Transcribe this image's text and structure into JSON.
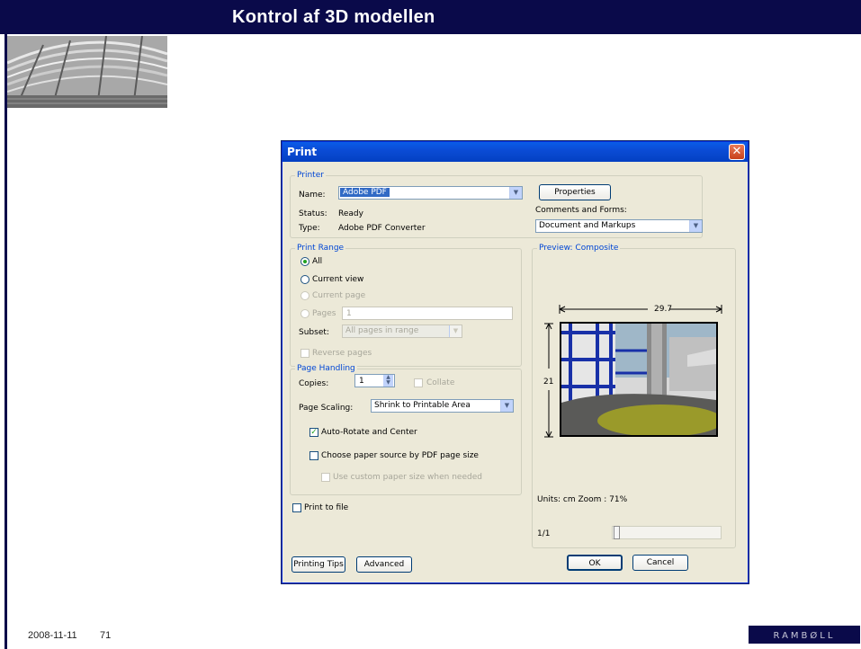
{
  "slide": {
    "title": "Kontrol af 3D modellen",
    "footer_date": "2008-11-11",
    "page_number": "71",
    "logo_text": "RAMBØLL"
  },
  "dialog": {
    "title": "Print",
    "close_glyph": "✕",
    "printer": {
      "legend": "Printer",
      "name_label": "Name:",
      "name_value": "Adobe PDF",
      "status_label": "Status:",
      "status_value": "Ready",
      "type_label": "Type:",
      "type_value": "Adobe PDF Converter",
      "properties_button": "Properties",
      "comments_label": "Comments and Forms:",
      "comments_value": "Document and Markups"
    },
    "print_range": {
      "legend": "Print Range",
      "all": "All",
      "current_view": "Current view",
      "current_page": "Current page",
      "pages_label": "Pages",
      "pages_value": "1",
      "subset_label": "Subset:",
      "subset_value": "All pages in range",
      "reverse_pages": "Reverse pages",
      "selected": "all"
    },
    "page_handling": {
      "legend": "Page Handling",
      "copies_label": "Copies:",
      "copies_value": "1",
      "collate": "Collate",
      "scaling_label": "Page Scaling:",
      "scaling_value": "Shrink to Printable Area",
      "auto_rotate": "Auto-Rotate and Center",
      "auto_rotate_checked": true,
      "paper_source": "Choose paper source by PDF page size",
      "paper_source_checked": false,
      "custom_paper": "Use custom paper size when needed"
    },
    "print_to_file": "Print to file",
    "print_to_file_checked": false,
    "preview": {
      "legend": "Preview: Composite",
      "width_label": "29.7",
      "height_label": "21",
      "units_zoom": "Units: cm Zoom : 71%",
      "page_counter": "1/1"
    },
    "buttons": {
      "printing_tips": "Printing Tips",
      "advanced": "Advanced",
      "ok": "OK",
      "cancel": "Cancel"
    }
  },
  "colors": {
    "slide_navy": "#0a0a4a",
    "xp_title_blue": "#0b4cd6",
    "group_legend": "#0046d5",
    "dialog_bg": "#ece9d8"
  }
}
